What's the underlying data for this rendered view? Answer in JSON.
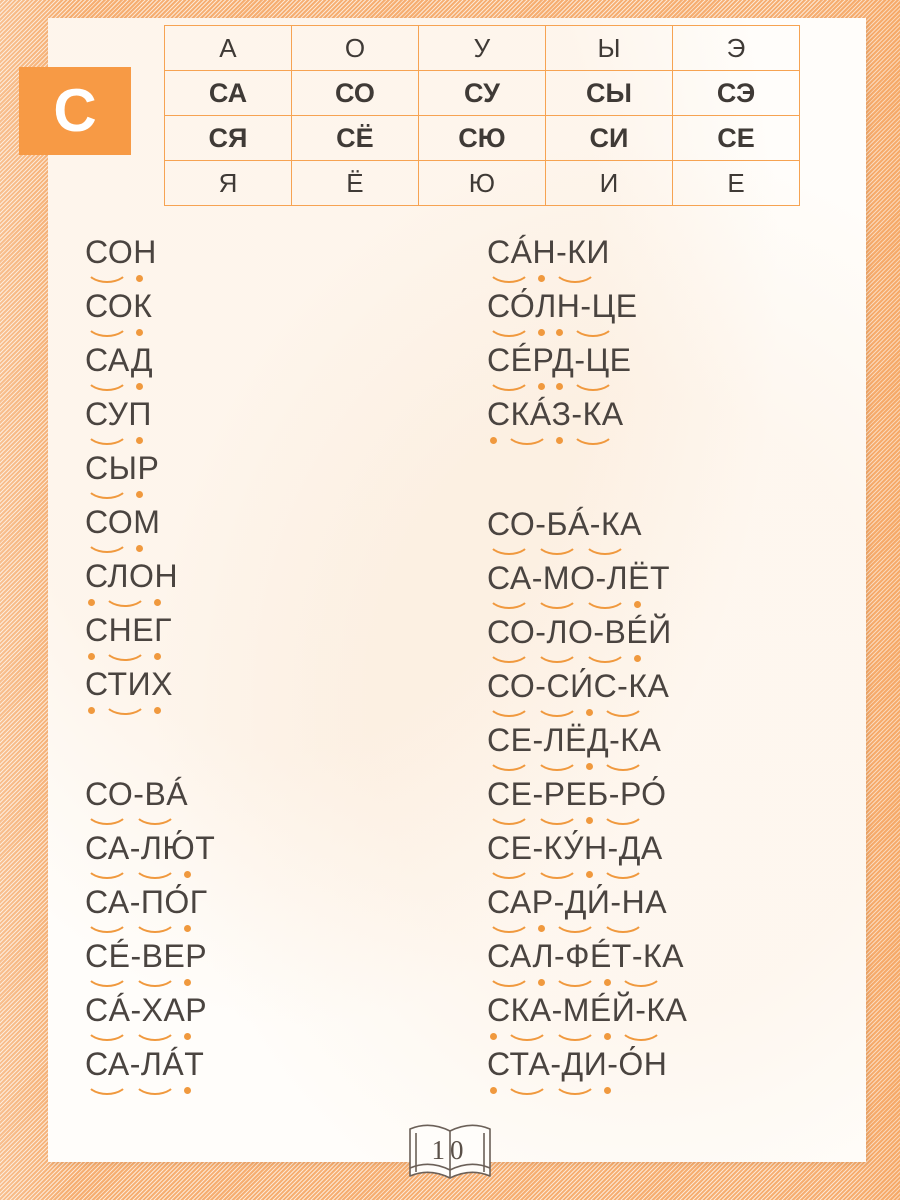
{
  "page": {
    "letter_badge": "С",
    "page_number": "10",
    "book_icon": "open-book-icon"
  },
  "colors": {
    "border_orange": "#f6a352",
    "badge_orange": "#f79a45",
    "mark_orange": "#f0993e",
    "text_dark": "#4a4440",
    "sheet_white": "#fffdfa"
  },
  "syllable_table": {
    "rows": [
      {
        "style": "vowel",
        "cells": [
          "А",
          "О",
          "У",
          "Ы",
          "Э"
        ]
      },
      {
        "style": "syllable",
        "cells": [
          "СА",
          "СО",
          "СУ",
          "СЫ",
          "СЭ"
        ]
      },
      {
        "style": "syllable",
        "cells": [
          "СЯ",
          "СЁ",
          "СЮ",
          "СИ",
          "СЕ"
        ]
      },
      {
        "style": "vowel",
        "cells": [
          "Я",
          "Ё",
          "Ю",
          "И",
          "Е"
        ]
      }
    ]
  },
  "columns": {
    "left": {
      "groups": [
        {
          "words": [
            {
              "text": "СОН",
              "marks": [
                "arc",
                "dot"
              ]
            },
            {
              "text": "СОК",
              "marks": [
                "arc",
                "dot"
              ]
            },
            {
              "text": "САД",
              "marks": [
                "arc",
                "dot"
              ]
            },
            {
              "text": "СУП",
              "marks": [
                "arc",
                "dot"
              ]
            },
            {
              "text": "СЫР",
              "marks": [
                "arc",
                "dot"
              ]
            },
            {
              "text": "СОМ",
              "marks": [
                "arc",
                "dot"
              ]
            },
            {
              "text": "СЛОН",
              "marks": [
                "dot",
                "arc",
                "dot"
              ]
            },
            {
              "text": "СНЕГ",
              "marks": [
                "dot",
                "arc",
                "dot"
              ]
            },
            {
              "text": "СТИХ",
              "marks": [
                "dot",
                "arc",
                "dot"
              ]
            }
          ]
        },
        {
          "words": [
            {
              "text": "СО-ВÁ",
              "marks": [
                "arc",
                "arc"
              ]
            },
            {
              "text": "СА-ЛЮ́Т",
              "marks": [
                "arc",
                "arc",
                "dot"
              ]
            },
            {
              "text": "СА-ПО́Г",
              "marks": [
                "arc",
                "arc",
                "dot"
              ]
            },
            {
              "text": "СÉ-ВЕР",
              "marks": [
                "arc",
                "arc",
                "dot"
              ]
            },
            {
              "text": "СÁ-ХАР",
              "marks": [
                "arc",
                "arc",
                "dot"
              ]
            },
            {
              "text": "СА-ЛÁТ",
              "marks": [
                "arc",
                "arc",
                "dot"
              ]
            }
          ]
        }
      ]
    },
    "right": {
      "groups": [
        {
          "words": [
            {
              "text": "СÁН-КИ",
              "marks": [
                "arc",
                "dot",
                "arc"
              ]
            },
            {
              "text": "СО́ЛН-ЦЕ",
              "marks": [
                "arc",
                "dot",
                "dot",
                "arc"
              ]
            },
            {
              "text": "СÉРД-ЦЕ",
              "marks": [
                "arc",
                "dot",
                "dot",
                "arc"
              ]
            },
            {
              "text": "СКÁЗ-КА",
              "marks": [
                "dot",
                "arc",
                "dot",
                "arc"
              ]
            }
          ]
        },
        {
          "words": [
            {
              "text": "СО-БÁ-КА",
              "marks": [
                "arc",
                "arc",
                "arc"
              ]
            },
            {
              "text": "СА-МО-ЛЁТ",
              "marks": [
                "arc",
                "arc",
                "arc",
                "dot"
              ]
            },
            {
              "text": "СО-ЛО-ВÉЙ",
              "marks": [
                "arc",
                "arc",
                "arc",
                "dot"
              ]
            },
            {
              "text": "СО-СИ́С-КА",
              "marks": [
                "arc",
                "arc",
                "dot",
                "arc"
              ]
            },
            {
              "text": "СЕ-ЛЁД-КА",
              "marks": [
                "arc",
                "arc",
                "dot",
                "arc"
              ]
            },
            {
              "text": "СЕ-РЕБ-РО́",
              "marks": [
                "arc",
                "arc",
                "dot",
                "arc"
              ]
            },
            {
              "text": "СЕ-КУ́Н-ДА",
              "marks": [
                "arc",
                "arc",
                "dot",
                "arc"
              ]
            },
            {
              "text": "САР-ДИ́-НА",
              "marks": [
                "arc",
                "dot",
                "arc",
                "arc"
              ]
            },
            {
              "text": "САЛ-ФÉТ-КА",
              "marks": [
                "arc",
                "dot",
                "arc",
                "dot",
                "arc"
              ]
            },
            {
              "text": "СКА-МÉЙ-КА",
              "marks": [
                "dot",
                "arc",
                "arc",
                "dot",
                "arc"
              ]
            },
            {
              "text": "СТА-ДИ-О́Н",
              "marks": [
                "dot",
                "arc",
                "arc",
                "dot"
              ]
            }
          ]
        }
      ]
    }
  }
}
